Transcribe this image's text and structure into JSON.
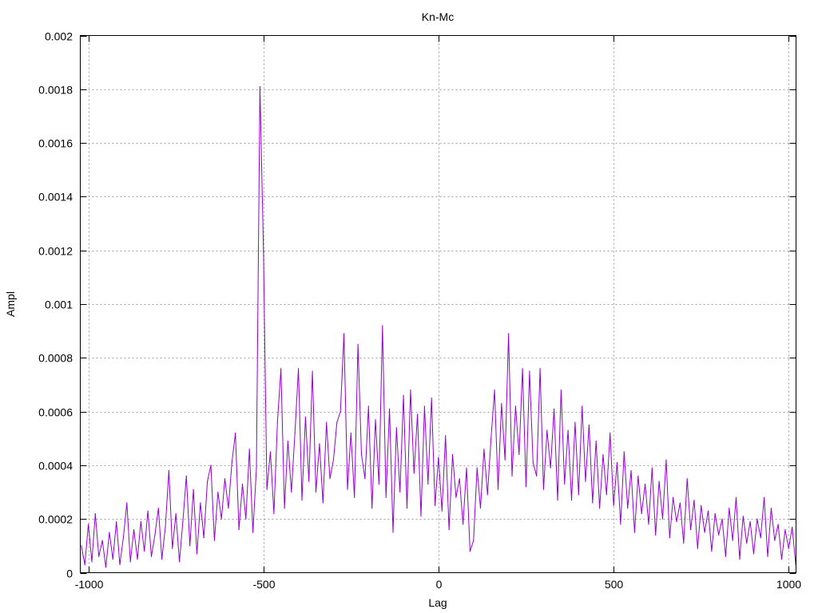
{
  "chart_data": {
    "type": "line",
    "title": "Kn-Mc",
    "xlabel": "Lag",
    "ylabel": "Ampl",
    "xlim": [
      -1023,
      1021
    ],
    "ylim": [
      0,
      0.002
    ],
    "grid": true,
    "legend": "none",
    "x_ticks": [
      -1000,
      -500,
      0,
      500,
      1000
    ],
    "x_tick_labels": [
      "-1000",
      "-500",
      "0",
      "500",
      "1000"
    ],
    "y_ticks": [
      0,
      0.0002,
      0.0004,
      0.0006,
      0.0008,
      0.001,
      0.0012,
      0.0014,
      0.0016,
      0.0018,
      0.002
    ],
    "y_tick_labels": [
      "0",
      "0.0002",
      "0.0004",
      "0.0006",
      "0.0008",
      "0.001",
      "0.0012",
      "0.0014",
      "0.0016",
      "0.0018",
      "0.002"
    ],
    "series": [
      {
        "name": "Kn-Mc",
        "color": "#9400d3",
        "x_start": -1020,
        "x_step": 10,
        "unit_multiplier": 0.0001,
        "values": [
          1.0,
          0.3,
          1.8,
          0.4,
          2.2,
          0.6,
          1.2,
          0.2,
          1.5,
          0.5,
          1.9,
          0.3,
          1.3,
          2.6,
          0.4,
          1.6,
          0.5,
          1.9,
          0.8,
          2.3,
          0.6,
          1.4,
          2.4,
          0.5,
          1.7,
          3.8,
          0.9,
          2.2,
          0.4,
          1.9,
          3.6,
          1.0,
          3.1,
          0.7,
          2.6,
          1.3,
          3.4,
          4.0,
          1.2,
          3.0,
          2.0,
          3.5,
          2.4,
          4.1,
          5.2,
          1.6,
          3.3,
          2.0,
          4.6,
          1.5,
          3.9,
          18.1,
          12.0,
          3.1,
          4.5,
          2.2,
          5.6,
          7.6,
          2.4,
          4.9,
          3.0,
          5.2,
          7.6,
          2.7,
          5.8,
          3.4,
          7.5,
          3.0,
          4.8,
          2.6,
          5.6,
          3.5,
          4.2,
          5.6,
          6.0,
          8.9,
          3.1,
          5.2,
          2.8,
          8.5,
          4.4,
          3.5,
          6.2,
          2.4,
          5.7,
          3.3,
          9.2,
          2.8,
          6.1,
          1.5,
          5.4,
          3.0,
          6.6,
          2.4,
          6.8,
          3.7,
          5.9,
          2.1,
          6.2,
          3.3,
          6.5,
          2.5,
          4.3,
          2.3,
          5.1,
          1.6,
          4.4,
          2.8,
          3.5,
          1.8,
          3.9,
          0.8,
          1.2,
          3.9,
          2.4,
          4.6,
          2.9,
          5.0,
          6.8,
          3.1,
          6.3,
          4.2,
          8.9,
          3.6,
          6.2,
          4.4,
          7.6,
          3.2,
          7.5,
          4.1,
          3.6,
          7.6,
          3.1,
          5.3,
          3.9,
          6.1,
          2.7,
          6.8,
          3.3,
          5.3,
          2.7,
          5.6,
          2.9,
          6.2,
          3.4,
          5.5,
          2.6,
          4.9,
          2.4,
          4.4,
          2.9,
          5.2,
          2.5,
          4.1,
          1.8,
          4.5,
          2.4,
          3.8,
          1.5,
          3.6,
          2.2,
          3.3,
          1.8,
          3.9,
          1.4,
          3.4,
          2.0,
          4.2,
          1.3,
          2.8,
          1.9,
          2.6,
          1.1,
          3.5,
          1.6,
          2.7,
          0.9,
          2.5,
          1.5,
          2.3,
          0.8,
          2.2,
          1.4,
          2.0,
          0.6,
          2.4,
          1.2,
          2.8,
          0.5,
          2.1,
          1.1,
          1.9,
          0.7,
          2.0,
          1.3,
          2.8,
          0.6,
          2.4,
          1.2,
          1.8,
          0.5,
          1.6,
          0.9,
          1.7,
          0.3
        ]
      }
    ]
  }
}
